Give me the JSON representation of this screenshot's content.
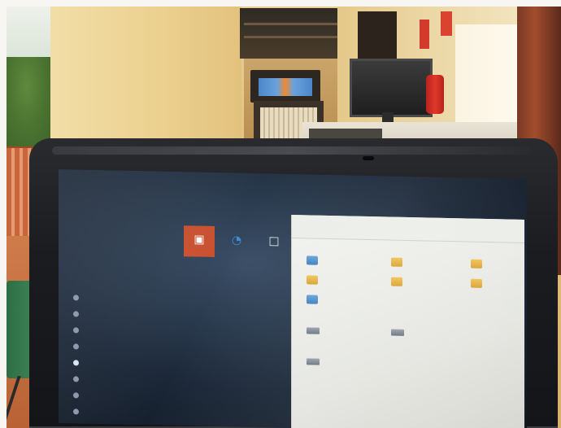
{
  "start_menu": {
    "title": "",
    "tile_group_label": "",
    "tiles": [
      {
        "label": "",
        "icon": "office-icon"
      },
      {
        "label": "",
        "icon": "edge-icon"
      },
      {
        "label": "",
        "icon": "store-icon"
      }
    ],
    "items": [
      {
        "label": "",
        "icon": "app-icon"
      },
      {
        "label": "",
        "icon": "app-icon"
      },
      {
        "label": "",
        "icon": "app-icon"
      },
      {
        "label": "",
        "icon": "app-icon"
      },
      {
        "label": "",
        "icon": "app-icon"
      },
      {
        "label": "",
        "icon": "app-icon"
      },
      {
        "label": "",
        "icon": "app-icon"
      },
      {
        "label": "",
        "icon": "gear-icon"
      }
    ]
  },
  "explorer": {
    "toolbar_label": "",
    "path": "",
    "sections": [
      {
        "title": ""
      },
      {
        "title": ""
      },
      {
        "title": ""
      }
    ],
    "folders": [
      {
        "name": "",
        "color": "#3d7fc0"
      },
      {
        "name": "",
        "color": "#d9a335"
      },
      {
        "name": "",
        "color": "#d9a335"
      },
      {
        "name": "",
        "color": "#d9a335"
      },
      {
        "name": "",
        "color": "#d9a335"
      },
      {
        "name": "",
        "color": "#d9a335"
      },
      {
        "name": "",
        "color": "#3d7fc0"
      }
    ],
    "drives": [
      {
        "name": ""
      },
      {
        "name": ""
      },
      {
        "name": ""
      }
    ]
  },
  "colors": {
    "office_tile": "#c8502f",
    "screen_background": "#1b2737",
    "explorer_background": "#e6e7e2"
  }
}
